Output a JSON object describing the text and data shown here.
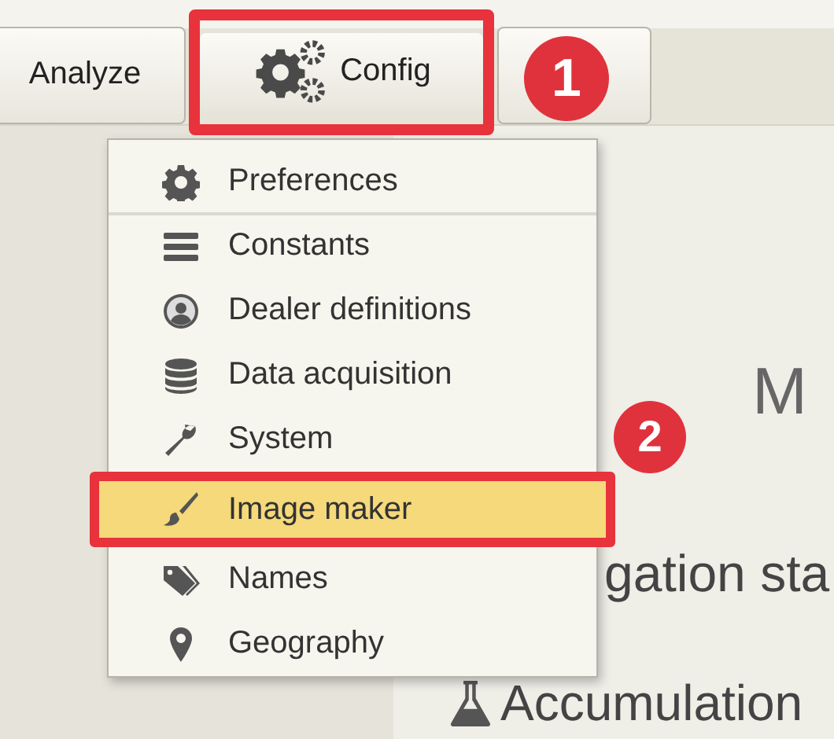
{
  "toolbar": {
    "buttons": [
      {
        "kind": "text",
        "label": "Analyze",
        "highlighted": false
      },
      {
        "kind": "gears",
        "label": "Config",
        "highlighted": true
      },
      {
        "kind": "blank",
        "highlighted": false
      }
    ]
  },
  "menu": {
    "items": [
      {
        "label": "Preferences",
        "selected": false,
        "highlighted": false,
        "separator_after": true
      },
      {
        "label": "Constants",
        "selected": false,
        "highlighted": false,
        "separator_after": false
      },
      {
        "label": "Dealer definitions",
        "selected": false,
        "highlighted": false,
        "separator_after": false
      },
      {
        "label": "Data acquisition",
        "selected": false,
        "highlighted": false,
        "separator_after": false
      },
      {
        "label": "System",
        "selected": false,
        "highlighted": false,
        "separator_after": false
      },
      {
        "label": "Image maker",
        "selected": true,
        "highlighted": true,
        "separator_after": false
      },
      {
        "label": "Names",
        "selected": false,
        "highlighted": false,
        "separator_after": false
      },
      {
        "label": "Geography",
        "selected": false,
        "highlighted": false,
        "separator_after": false
      }
    ]
  },
  "background": {
    "heading": "M",
    "subheading": "gation sta",
    "section": {
      "label": "Accumulation"
    }
  },
  "callouts": [
    {
      "number": "1"
    },
    {
      "number": "2"
    }
  ]
}
